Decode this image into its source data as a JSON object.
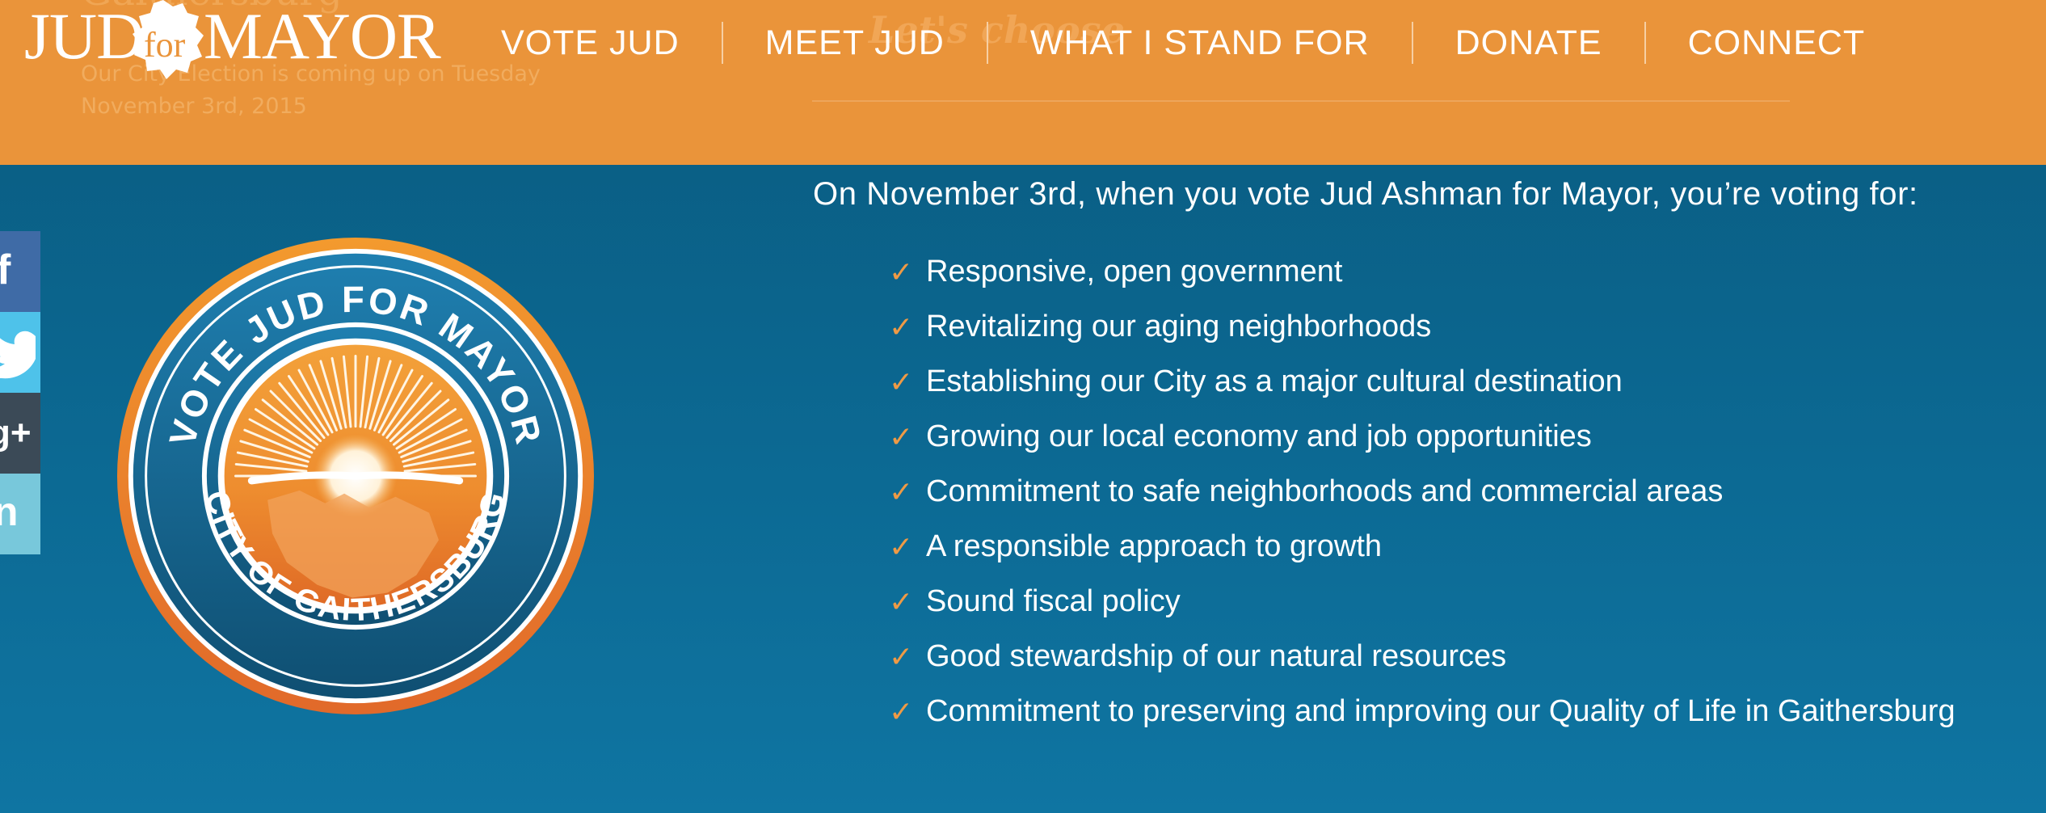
{
  "header": {
    "logo": {
      "jud": "JUD",
      "for": "for",
      "mayor": "MAYOR"
    },
    "background_text": {
      "title": "Gaithersburg",
      "line1": "Our City Election is coming up on Tuesday",
      "line2": "November 3rd, 2015",
      "script": "Let's choose"
    },
    "nav": [
      {
        "label": "VOTE JUD"
      },
      {
        "label": "MEET JUD"
      },
      {
        "label": "WHAT I STAND FOR"
      },
      {
        "label": "DONATE"
      },
      {
        "label": "CONNECT"
      }
    ]
  },
  "social": {
    "facebook": "f",
    "twitter": "t",
    "googleplus": "g+",
    "linkedin": "in"
  },
  "seal": {
    "top_text": "VOTE JUD FOR MAYOR",
    "bottom_text": "CITY OF GAITHERSBURG"
  },
  "content": {
    "headline": "On November 3rd, when you vote Jud Ashman for Mayor, you’re voting for:",
    "check_glyph": "✓",
    "items": [
      "Responsive, open government",
      "Revitalizing our aging neighborhoods",
      "Establishing our City as a major cultural destination",
      "Growing our local economy and job opportunities",
      "Commitment to safe neighborhoods and commercial areas",
      "A responsible approach to growth",
      "Sound fiscal policy",
      "Good stewardship of our natural resources",
      "Commitment to preserving and improving our Quality of Life in Gaithersburg"
    ]
  },
  "colors": {
    "header_orange": "#ea943a",
    "body_blue": "#0b668f",
    "check_orange": "#ef9a45",
    "facebook": "#3f6ba6",
    "twitter": "#4ec2ea",
    "googleplus": "#3b4a57",
    "linkedin": "#78c8db"
  },
  "icons": [
    "map-badge-icon",
    "facebook-icon",
    "twitter-icon",
    "google-plus-icon",
    "linkedin-icon",
    "checkmark-icon",
    "sunrise-icon"
  ]
}
